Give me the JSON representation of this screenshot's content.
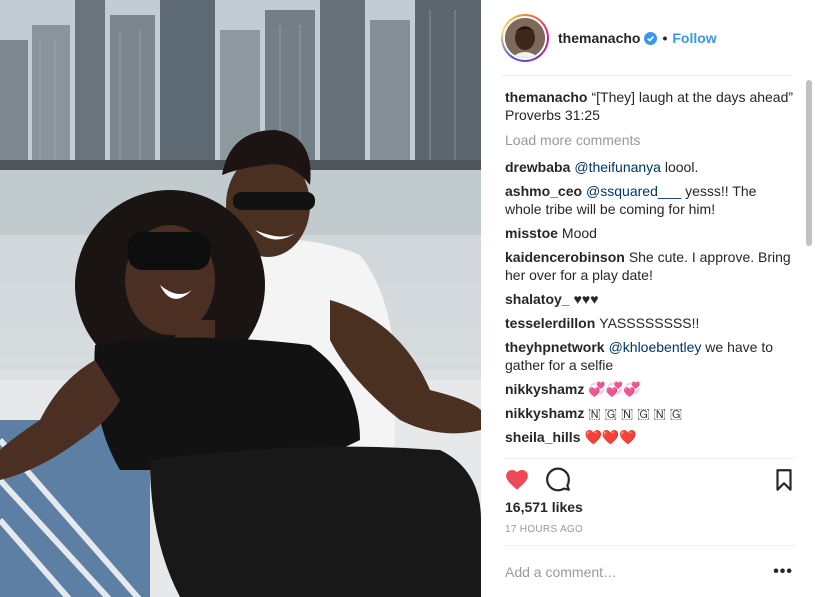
{
  "post": {
    "username": "themanacho",
    "follow_label": "Follow",
    "separator": "•",
    "verified_icon": "verified-badge-icon",
    "photo_alt": "Two people laughing on a rooftop"
  },
  "caption": {
    "user": "themanacho",
    "text": "“[They] laugh at the days ahead”",
    "reference": "Proverbs 31:25"
  },
  "load_more_label": "Load more comments",
  "comments": [
    {
      "user": "drewbaba",
      "mention": "@theifunanya",
      "text": " loool."
    },
    {
      "user": "ashmo_ceo",
      "mention": "@ssquared___",
      "text": " yesss!! The whole tribe will be coming for him!"
    },
    {
      "user": "misstoe",
      "mention": "",
      "text": "Mood"
    },
    {
      "user": "kaidencerobinson",
      "mention": "",
      "text": "She cute. I approve. Bring her over for a play date!"
    },
    {
      "user": "shalatoy_",
      "mention": "",
      "text": "♥♥♥"
    },
    {
      "user": "tesselerdillon",
      "mention": "",
      "text": "YASSSSSSSS!!"
    },
    {
      "user": "theyhpnetwork",
      "mention": "@khloebentley",
      "text": " we have to gather for a selfie"
    },
    {
      "user": "nikkyshamz",
      "mention": "",
      "text": "💞💞💞"
    },
    {
      "user": "nikkyshamz",
      "mention": "",
      "text": "🇳 🇬 🇳 🇬 🇳 🇬"
    },
    {
      "user": "sheila_hills",
      "mention": "",
      "text": "❤️❤️❤️"
    }
  ],
  "likes_label": "16,571 likes",
  "timestamp": "17 HOURS AGO",
  "comment_input": {
    "placeholder": "Add a comment…"
  },
  "more_label": "•••",
  "icons": {
    "like": "heart-filled-icon",
    "comment": "comment-bubble-icon",
    "save": "bookmark-icon"
  },
  "colors": {
    "accent": "#3897f0",
    "like": "#ed4956",
    "text": "#262626",
    "muted": "#999999",
    "mention": "#003569"
  }
}
